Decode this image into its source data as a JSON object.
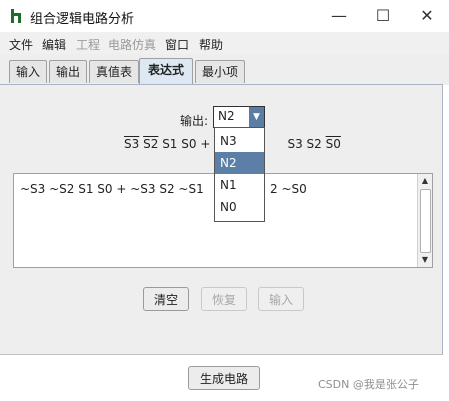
{
  "window": {
    "title": "组合逻辑电路分析",
    "minimize_glyph": "—",
    "maximize_glyph": "☐",
    "close_glyph": "✕"
  },
  "menu": [
    "文件",
    "编辑",
    "工程",
    "电路仿真",
    "窗口",
    "帮助"
  ],
  "tabs": [
    "输入",
    "输出",
    "真值表",
    "表达式",
    "最小项"
  ],
  "output_selector": {
    "label": "输出:",
    "value": "N2",
    "options": [
      "N3",
      "N2",
      "N1",
      "N0"
    ]
  },
  "expression_display": {
    "line1": "S3",
    "line2": "S2",
    "line3": "S1 S0 + S",
    "line4": "S3 S2",
    "line5": "S0"
  },
  "expression_text": "~S3 ~S2 S1 S0 + ~S3 S2 ~S1",
  "expression_text_tail": "2 ~S0",
  "buttons": {
    "clear": "清空",
    "revert": "恢复",
    "enter": "输入",
    "build_circuit": "生成电路"
  },
  "watermark": "CSDN @我是张公子"
}
